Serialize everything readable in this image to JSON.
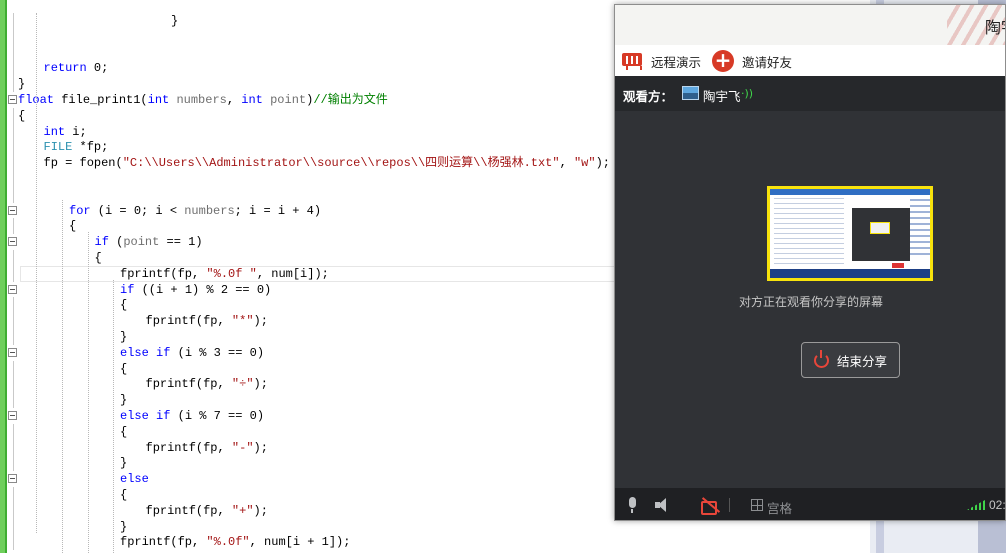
{
  "editor": {
    "lines": [
      {
        "tokens": [
          {
            "t": "}",
            "c": ""
          }
        ],
        "fold": false
      },
      {
        "tokens": [],
        "fold": false
      },
      {
        "tokens": [],
        "fold": false
      },
      {
        "tokens": [
          {
            "t": "return",
            "c": "kw"
          },
          {
            "t": " 0;",
            "c": ""
          }
        ],
        "fold": false
      },
      {
        "tokens": [
          {
            "t": "}",
            "c": ""
          }
        ],
        "fold": false
      },
      {
        "tokens": [
          {
            "t": "float",
            "c": "kw"
          },
          {
            "t": " file_print1(",
            "c": ""
          },
          {
            "t": "int",
            "c": "kw"
          },
          {
            "t": " ",
            "c": ""
          },
          {
            "t": "numbers",
            "c": "id"
          },
          {
            "t": ", ",
            "c": ""
          },
          {
            "t": "int",
            "c": "kw"
          },
          {
            "t": " ",
            "c": ""
          },
          {
            "t": "point",
            "c": "id"
          },
          {
            "t": ")",
            "c": ""
          },
          {
            "t": "//输出为文件",
            "c": "cm"
          }
        ],
        "fold": true
      },
      {
        "tokens": [
          {
            "t": "{",
            "c": ""
          }
        ],
        "fold": false
      },
      {
        "tokens": [
          {
            "t": "int",
            "c": "kw"
          },
          {
            "t": " i;",
            "c": ""
          }
        ],
        "fold": false
      },
      {
        "tokens": [
          {
            "t": "FILE",
            "c": "ty"
          },
          {
            "t": " *fp;",
            "c": ""
          }
        ],
        "fold": false
      },
      {
        "tokens": [
          {
            "t": "fp = fopen(",
            "c": ""
          },
          {
            "t": "\"C:\\\\Users\\\\Administrator\\\\source\\\\repos\\\\四则运算\\\\杨强林.txt\"",
            "c": "str"
          },
          {
            "t": ", ",
            "c": ""
          },
          {
            "t": "\"w\"",
            "c": "str"
          },
          {
            "t": ");",
            "c": ""
          }
        ],
        "fold": false
      },
      {
        "tokens": [],
        "fold": false
      },
      {
        "tokens": [],
        "fold": false
      },
      {
        "tokens": [
          {
            "t": "for",
            "c": "kw"
          },
          {
            "t": " (i = 0; i < ",
            "c": ""
          },
          {
            "t": "numbers",
            "c": "id"
          },
          {
            "t": "; i = i + 4)",
            "c": ""
          }
        ],
        "fold": true
      },
      {
        "tokens": [
          {
            "t": "{",
            "c": ""
          }
        ],
        "fold": false
      },
      {
        "tokens": [
          {
            "t": "if",
            "c": "kw"
          },
          {
            "t": " (",
            "c": ""
          },
          {
            "t": "point",
            "c": "id"
          },
          {
            "t": " == 1)",
            "c": ""
          }
        ],
        "fold": true
      },
      {
        "tokens": [
          {
            "t": "{",
            "c": ""
          }
        ],
        "fold": false
      },
      {
        "tokens": [
          {
            "t": "fprintf(fp, ",
            "c": ""
          },
          {
            "t": "\"%.0f \"",
            "c": "str"
          },
          {
            "t": ", num[i]);",
            "c": ""
          }
        ],
        "fold": false
      },
      {
        "tokens": [
          {
            "t": "if",
            "c": "kw"
          },
          {
            "t": " ((i + 1) % 2 == 0)",
            "c": ""
          }
        ],
        "fold": true
      },
      {
        "tokens": [
          {
            "t": "{",
            "c": ""
          }
        ],
        "fold": false
      },
      {
        "tokens": [
          {
            "t": "fprintf(fp, ",
            "c": ""
          },
          {
            "t": "\"*\"",
            "c": "str"
          },
          {
            "t": ");",
            "c": ""
          }
        ],
        "fold": false
      },
      {
        "tokens": [
          {
            "t": "}",
            "c": ""
          }
        ],
        "fold": false
      },
      {
        "tokens": [
          {
            "t": "else if",
            "c": "kw"
          },
          {
            "t": " (i % 3 == 0)",
            "c": ""
          }
        ],
        "fold": true
      },
      {
        "tokens": [
          {
            "t": "{",
            "c": ""
          }
        ],
        "fold": false
      },
      {
        "tokens": [
          {
            "t": "fprintf(fp, ",
            "c": ""
          },
          {
            "t": "\"÷\"",
            "c": "str"
          },
          {
            "t": ");",
            "c": ""
          }
        ],
        "fold": false
      },
      {
        "tokens": [
          {
            "t": "}",
            "c": ""
          }
        ],
        "fold": false
      },
      {
        "tokens": [
          {
            "t": "else if",
            "c": "kw"
          },
          {
            "t": " (i % 7 == 0)",
            "c": ""
          }
        ],
        "fold": true
      },
      {
        "tokens": [
          {
            "t": "{",
            "c": ""
          }
        ],
        "fold": false
      },
      {
        "tokens": [
          {
            "t": "fprintf(fp, ",
            "c": ""
          },
          {
            "t": "\"-\"",
            "c": "str"
          },
          {
            "t": ");",
            "c": ""
          }
        ],
        "fold": false
      },
      {
        "tokens": [
          {
            "t": "}",
            "c": ""
          }
        ],
        "fold": false
      },
      {
        "tokens": [
          {
            "t": "else",
            "c": "kw"
          }
        ],
        "fold": true
      },
      {
        "tokens": [
          {
            "t": "{",
            "c": ""
          }
        ],
        "fold": false
      },
      {
        "tokens": [
          {
            "t": "fprintf(fp, ",
            "c": ""
          },
          {
            "t": "\"+\"",
            "c": "str"
          },
          {
            "t": ");",
            "c": ""
          }
        ],
        "fold": false
      },
      {
        "tokens": [
          {
            "t": "}",
            "c": ""
          }
        ],
        "fold": false
      },
      {
        "tokens": [
          {
            "t": "fprintf(fp, ",
            "c": ""
          },
          {
            "t": "\"%.0f\"",
            "c": "str"
          },
          {
            "t": ", num[i + 1]);",
            "c": ""
          }
        ],
        "fold": false
      }
    ]
  },
  "share_window": {
    "title_name": "陶宇",
    "toolbar": {
      "remote_present_label": "远程演示",
      "invite_label": "邀请好友"
    },
    "viewers": {
      "label": "观看方：",
      "name": "陶宇飞",
      "signal": "·))"
    },
    "watching_text": "对方正在观看你分享的屏幕",
    "end_share_label": "结束分享",
    "bottom": {
      "grid_label": "宫格",
      "timer": "02:"
    },
    "colors": {
      "accent": "#d73a26",
      "preview_border": "#f7e20c",
      "signal": "#3fd44a"
    }
  }
}
